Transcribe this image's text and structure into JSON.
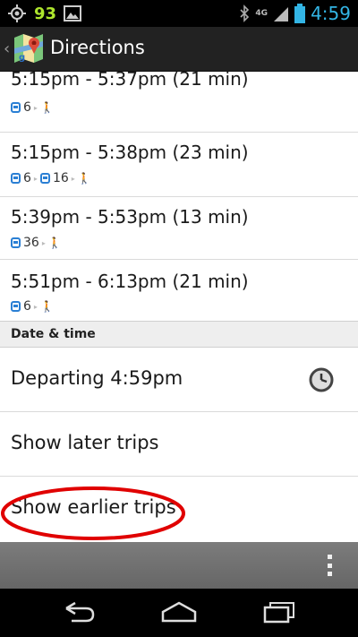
{
  "status_bar": {
    "notification_number": "93",
    "network": "4G",
    "time": "4:59",
    "icons": [
      "gps-icon",
      "image-icon",
      "bluetooth-icon",
      "signal-icon",
      "battery-icon"
    ]
  },
  "action_bar": {
    "title": "Directions",
    "app_icon": "maps-icon"
  },
  "trips": [
    {
      "time": "5:15pm - 5:37pm (21 min)",
      "route": [
        "6"
      ]
    },
    {
      "time": "5:15pm - 5:38pm (23 min)",
      "route": [
        "6",
        "16"
      ]
    },
    {
      "time": "5:39pm - 5:53pm (13 min)",
      "route": [
        "36"
      ]
    },
    {
      "time": "5:51pm - 6:13pm (21 min)",
      "route": [
        "6"
      ]
    }
  ],
  "date_time": {
    "header": "Date & time",
    "departing": "Departing 4:59pm"
  },
  "actions": {
    "later": "Show later trips",
    "earlier": "Show earlier trips"
  },
  "colors": {
    "accent": "#33b5e5",
    "highlight": "#e00000",
    "bus": "#2a7fd4"
  }
}
